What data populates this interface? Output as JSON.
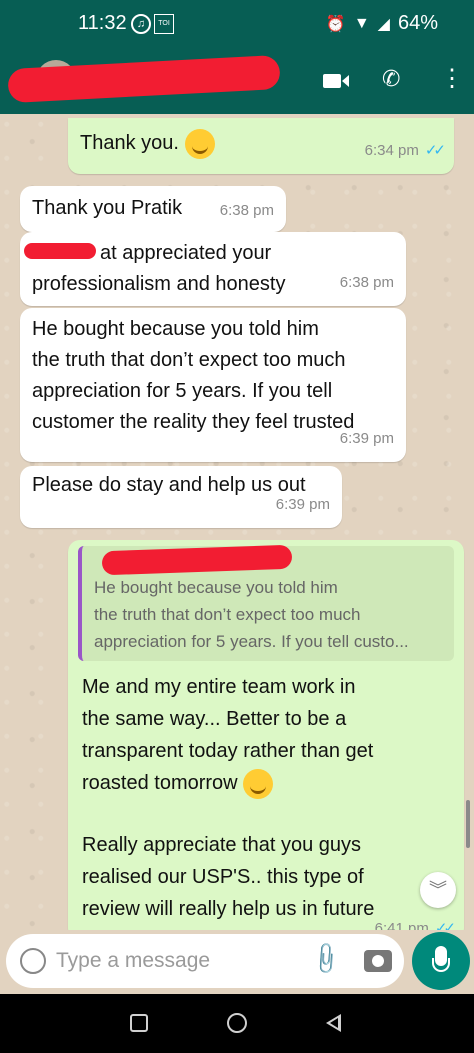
{
  "status_bar": {
    "time": "11:32",
    "battery": "64%",
    "notification_badge": "TOI"
  },
  "header": {
    "contact_name": "",
    "icons": [
      "back-arrow-icon",
      "video-call-icon",
      "voice-call-icon",
      "more-vert-icon"
    ]
  },
  "messages": [
    {
      "direction": "out",
      "text": "Thank you.",
      "time": "6:34 pm",
      "read": true,
      "emoji": "smiling-face"
    },
    {
      "direction": "in",
      "text": "Thank you Pratik",
      "time": "6:38 pm"
    },
    {
      "direction": "in",
      "text_line1": "at appreciated your",
      "text_line2": "professionalism and honesty",
      "time": "6:38 pm"
    },
    {
      "direction": "in",
      "lines": [
        "He bought because you told him",
        "the truth that don’t expect too much",
        "appreciation for 5 years. If you tell",
        "customer the reality they feel trusted"
      ],
      "time": "6:39 pm"
    },
    {
      "direction": "in",
      "text": "Please do stay and help us out",
      "time": "6:39 pm"
    },
    {
      "direction": "out",
      "quote": {
        "lines": [
          "He bought because you told him",
          "the truth that don’t expect too much",
          "appreciation for 5 years. If you tell custo..."
        ]
      },
      "lines": [
        "Me and my entire team work in",
        "the same way... Better to be a",
        "transparent today rather than get",
        "roasted tomorrow"
      ],
      "lines2": [
        "Really appreciate that you guys",
        "realised our USP'S.. this type of",
        "review will  really help us in future"
      ],
      "time": "6:41 pm",
      "emoji": "grinning-face"
    }
  ],
  "composer": {
    "placeholder": "Type a message"
  },
  "colors": {
    "header": "#075e54",
    "outgoing_bubble": "#dcf8c6",
    "incoming_bubble": "#ffffff",
    "mic_button": "#00897b",
    "read_ticks": "#34b7f1"
  }
}
